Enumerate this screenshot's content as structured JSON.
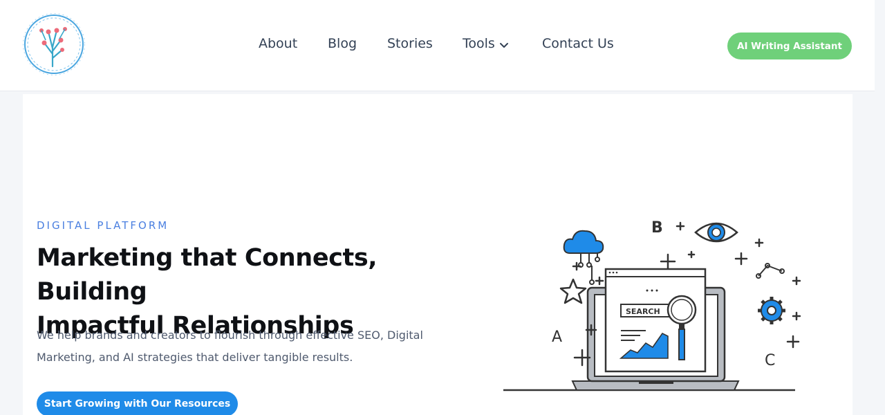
{
  "header": {
    "logo_icon": "brain-circuit-logo-icon",
    "nav": [
      {
        "label": "About"
      },
      {
        "label": "Blog"
      },
      {
        "label": "Stories"
      },
      {
        "label": "Tools",
        "has_dropdown": true
      },
      {
        "label": "Contact Us"
      }
    ],
    "cta_label": "AI Writing Assistant"
  },
  "hero": {
    "eyebrow": "DIGITAL PLATFORM",
    "headline_line1": "Marketing that Connects, Building",
    "headline_line2": "Impactful Relationships",
    "description_line1": "We help brands and creators to flourish through effective SEO, Digital",
    "description_line2": "Marketing, and AI strategies that deliver tangible results.",
    "cta_label": "Start Growing with Our Resources",
    "illustration": {
      "search_label": "SEARCH",
      "letters": [
        "A",
        "B",
        "C"
      ]
    }
  },
  "colors": {
    "accent_blue": "#4a7fe0",
    "cta_blue": "#1f8be8",
    "cta_green": "#6fd07a",
    "illustration_blue": "#1f8be8",
    "text_dark": "#0f1115",
    "text_body": "#4f5a6e"
  }
}
